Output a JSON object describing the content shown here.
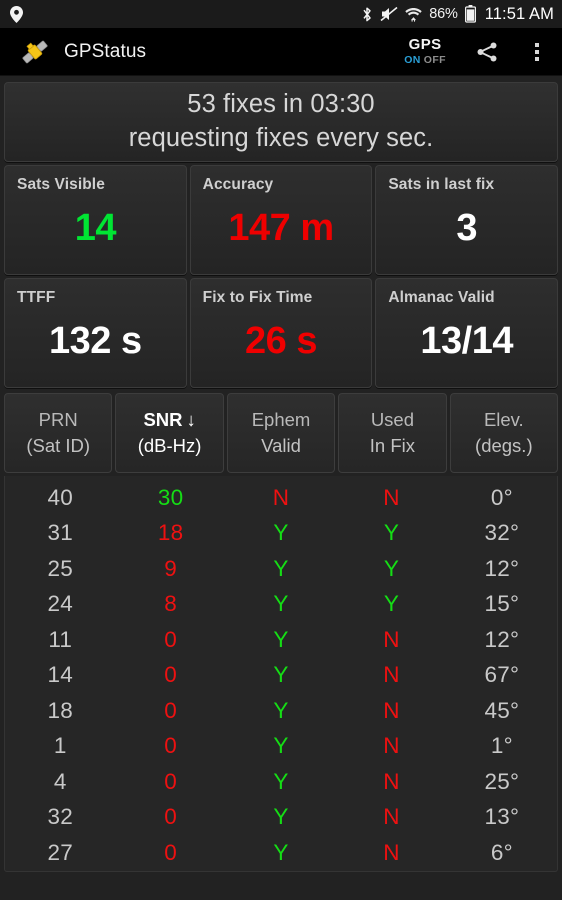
{
  "statusbar": {
    "location_icon": "location-pin-icon",
    "bluetooth_icon": "bluetooth-icon",
    "mute_icon": "volume-mute-icon",
    "wifi_icon": "wifi-icon",
    "battery_percent": "86%",
    "battery_icon": "battery-icon",
    "clock": "11:51 AM"
  },
  "actionbar": {
    "app_icon": "satellite-icon",
    "title": "GPStatus",
    "gps_toggle": {
      "label": "GPS",
      "on": "ON",
      "off": "OFF",
      "state": "on"
    },
    "share_icon": "share-icon",
    "overflow_icon": "overflow-menu-icon"
  },
  "banner": {
    "line1": "53 fixes in 03:30",
    "line2": "requesting fixes every sec."
  },
  "stats": [
    {
      "label": "Sats Visible",
      "value": "14",
      "color": "#00e533"
    },
    {
      "label": "Accuracy",
      "value": "147 m",
      "color": "#ef0000"
    },
    {
      "label": "Sats in last fix",
      "value": "3",
      "color": "#ffffff"
    },
    {
      "label": "TTFF",
      "value": "132 s",
      "color": "#ffffff"
    },
    {
      "label": "Fix to Fix Time",
      "value": "26 s",
      "color": "#ef0000"
    },
    {
      "label": "Almanac Valid",
      "value": "13/14",
      "color": "#ffffff"
    }
  ],
  "table": {
    "columns": [
      {
        "top": "PRN",
        "sub": "(Sat ID)",
        "sorted": false,
        "sort_arrow": ""
      },
      {
        "top": "SNR",
        "sub": "(dB-Hz)",
        "sorted": true,
        "sort_arrow": "↓"
      },
      {
        "top": "Ephem",
        "sub": "Valid",
        "sorted": false,
        "sort_arrow": ""
      },
      {
        "top": "Used",
        "sub": "In Fix",
        "sorted": false,
        "sort_arrow": ""
      },
      {
        "top": "Elev.",
        "sub": "(degs.)",
        "sorted": false,
        "sort_arrow": ""
      }
    ],
    "rows": [
      {
        "prn": "40",
        "snr": "30",
        "snr_color": "green",
        "ephem": "N",
        "ephem_color": "red",
        "used": "N",
        "used_color": "red",
        "elev": "0°"
      },
      {
        "prn": "31",
        "snr": "18",
        "snr_color": "red",
        "ephem": "Y",
        "ephem_color": "green",
        "used": "Y",
        "used_color": "green",
        "elev": "32°"
      },
      {
        "prn": "25",
        "snr": "9",
        "snr_color": "red",
        "ephem": "Y",
        "ephem_color": "green",
        "used": "Y",
        "used_color": "green",
        "elev": "12°"
      },
      {
        "prn": "24",
        "snr": "8",
        "snr_color": "red",
        "ephem": "Y",
        "ephem_color": "green",
        "used": "Y",
        "used_color": "green",
        "elev": "15°"
      },
      {
        "prn": "11",
        "snr": "0",
        "snr_color": "red",
        "ephem": "Y",
        "ephem_color": "green",
        "used": "N",
        "used_color": "red",
        "elev": "12°"
      },
      {
        "prn": "14",
        "snr": "0",
        "snr_color": "red",
        "ephem": "Y",
        "ephem_color": "green",
        "used": "N",
        "used_color": "red",
        "elev": "67°"
      },
      {
        "prn": "18",
        "snr": "0",
        "snr_color": "red",
        "ephem": "Y",
        "ephem_color": "green",
        "used": "N",
        "used_color": "red",
        "elev": "45°"
      },
      {
        "prn": "1",
        "snr": "0",
        "snr_color": "red",
        "ephem": "Y",
        "ephem_color": "green",
        "used": "N",
        "used_color": "red",
        "elev": "1°"
      },
      {
        "prn": "4",
        "snr": "0",
        "snr_color": "red",
        "ephem": "Y",
        "ephem_color": "green",
        "used": "N",
        "used_color": "red",
        "elev": "25°"
      },
      {
        "prn": "32",
        "snr": "0",
        "snr_color": "red",
        "ephem": "Y",
        "ephem_color": "green",
        "used": "N",
        "used_color": "red",
        "elev": "13°"
      },
      {
        "prn": "27",
        "snr": "0",
        "snr_color": "red",
        "ephem": "Y",
        "ephem_color": "green",
        "used": "N",
        "used_color": "red",
        "elev": "6°"
      }
    ]
  },
  "colors": {
    "accent_blue": "#2a9fd6",
    "good_green": "#00e533",
    "bad_red": "#ef0000",
    "background": "#222222"
  }
}
